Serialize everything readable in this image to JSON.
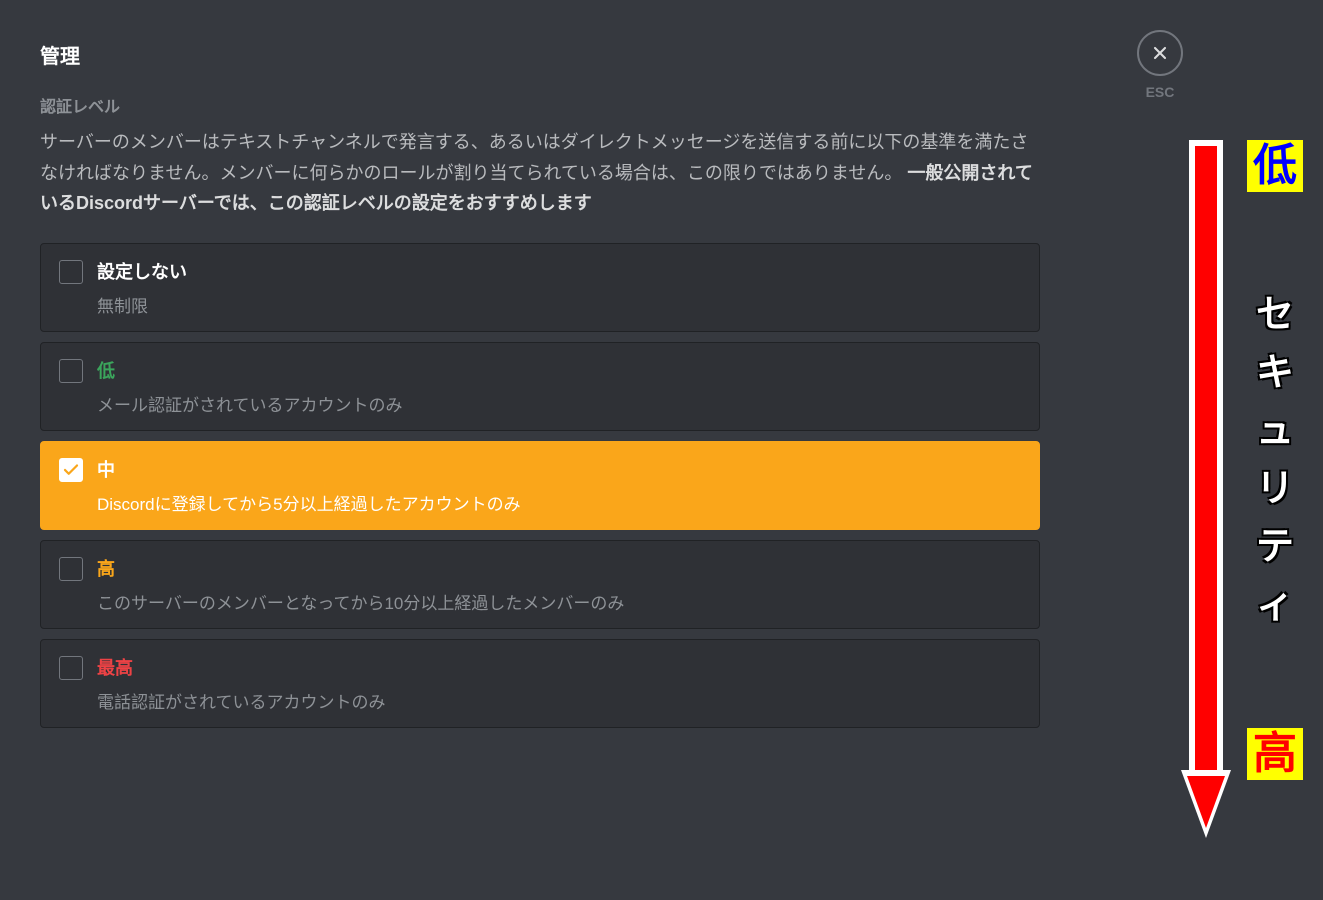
{
  "header": {
    "title": "管理",
    "close_label": "ESC"
  },
  "section": {
    "label": "認証レベル",
    "description_part1": "サーバーのメンバーはテキストチャンネルで発言する、あるいはダイレクトメッセージを送信する前に以下の基準を満たさなければなりません。メンバーに何らかのロールが割り当てられている場合は、この限りではありません。 ",
    "description_emphasis": "一般公開されているDiscordサーバーでは、この認証レベルの設定をおすすめします"
  },
  "options": [
    {
      "title": "設定しない",
      "desc": "無制限",
      "color_class": "color-none",
      "selected": false
    },
    {
      "title": "低",
      "desc": "メール認証がされているアカウントのみ",
      "color_class": "color-low",
      "selected": false
    },
    {
      "title": "中",
      "desc": "Discordに登録してから5分以上経過したアカウントのみ",
      "color_class": "",
      "selected": true
    },
    {
      "title": "高",
      "desc": "このサーバーのメンバーとなってから10分以上経過したメンバーのみ",
      "color_class": "color-high",
      "selected": false
    },
    {
      "title": "最高",
      "desc": "電話認証がされているアカウントのみ",
      "color_class": "color-highest",
      "selected": false
    }
  ],
  "annotation": {
    "low_label": "低",
    "high_label": "高",
    "security_chars": [
      "セ",
      "キ",
      "ュ",
      "リ",
      "テ",
      "ィ"
    ]
  }
}
